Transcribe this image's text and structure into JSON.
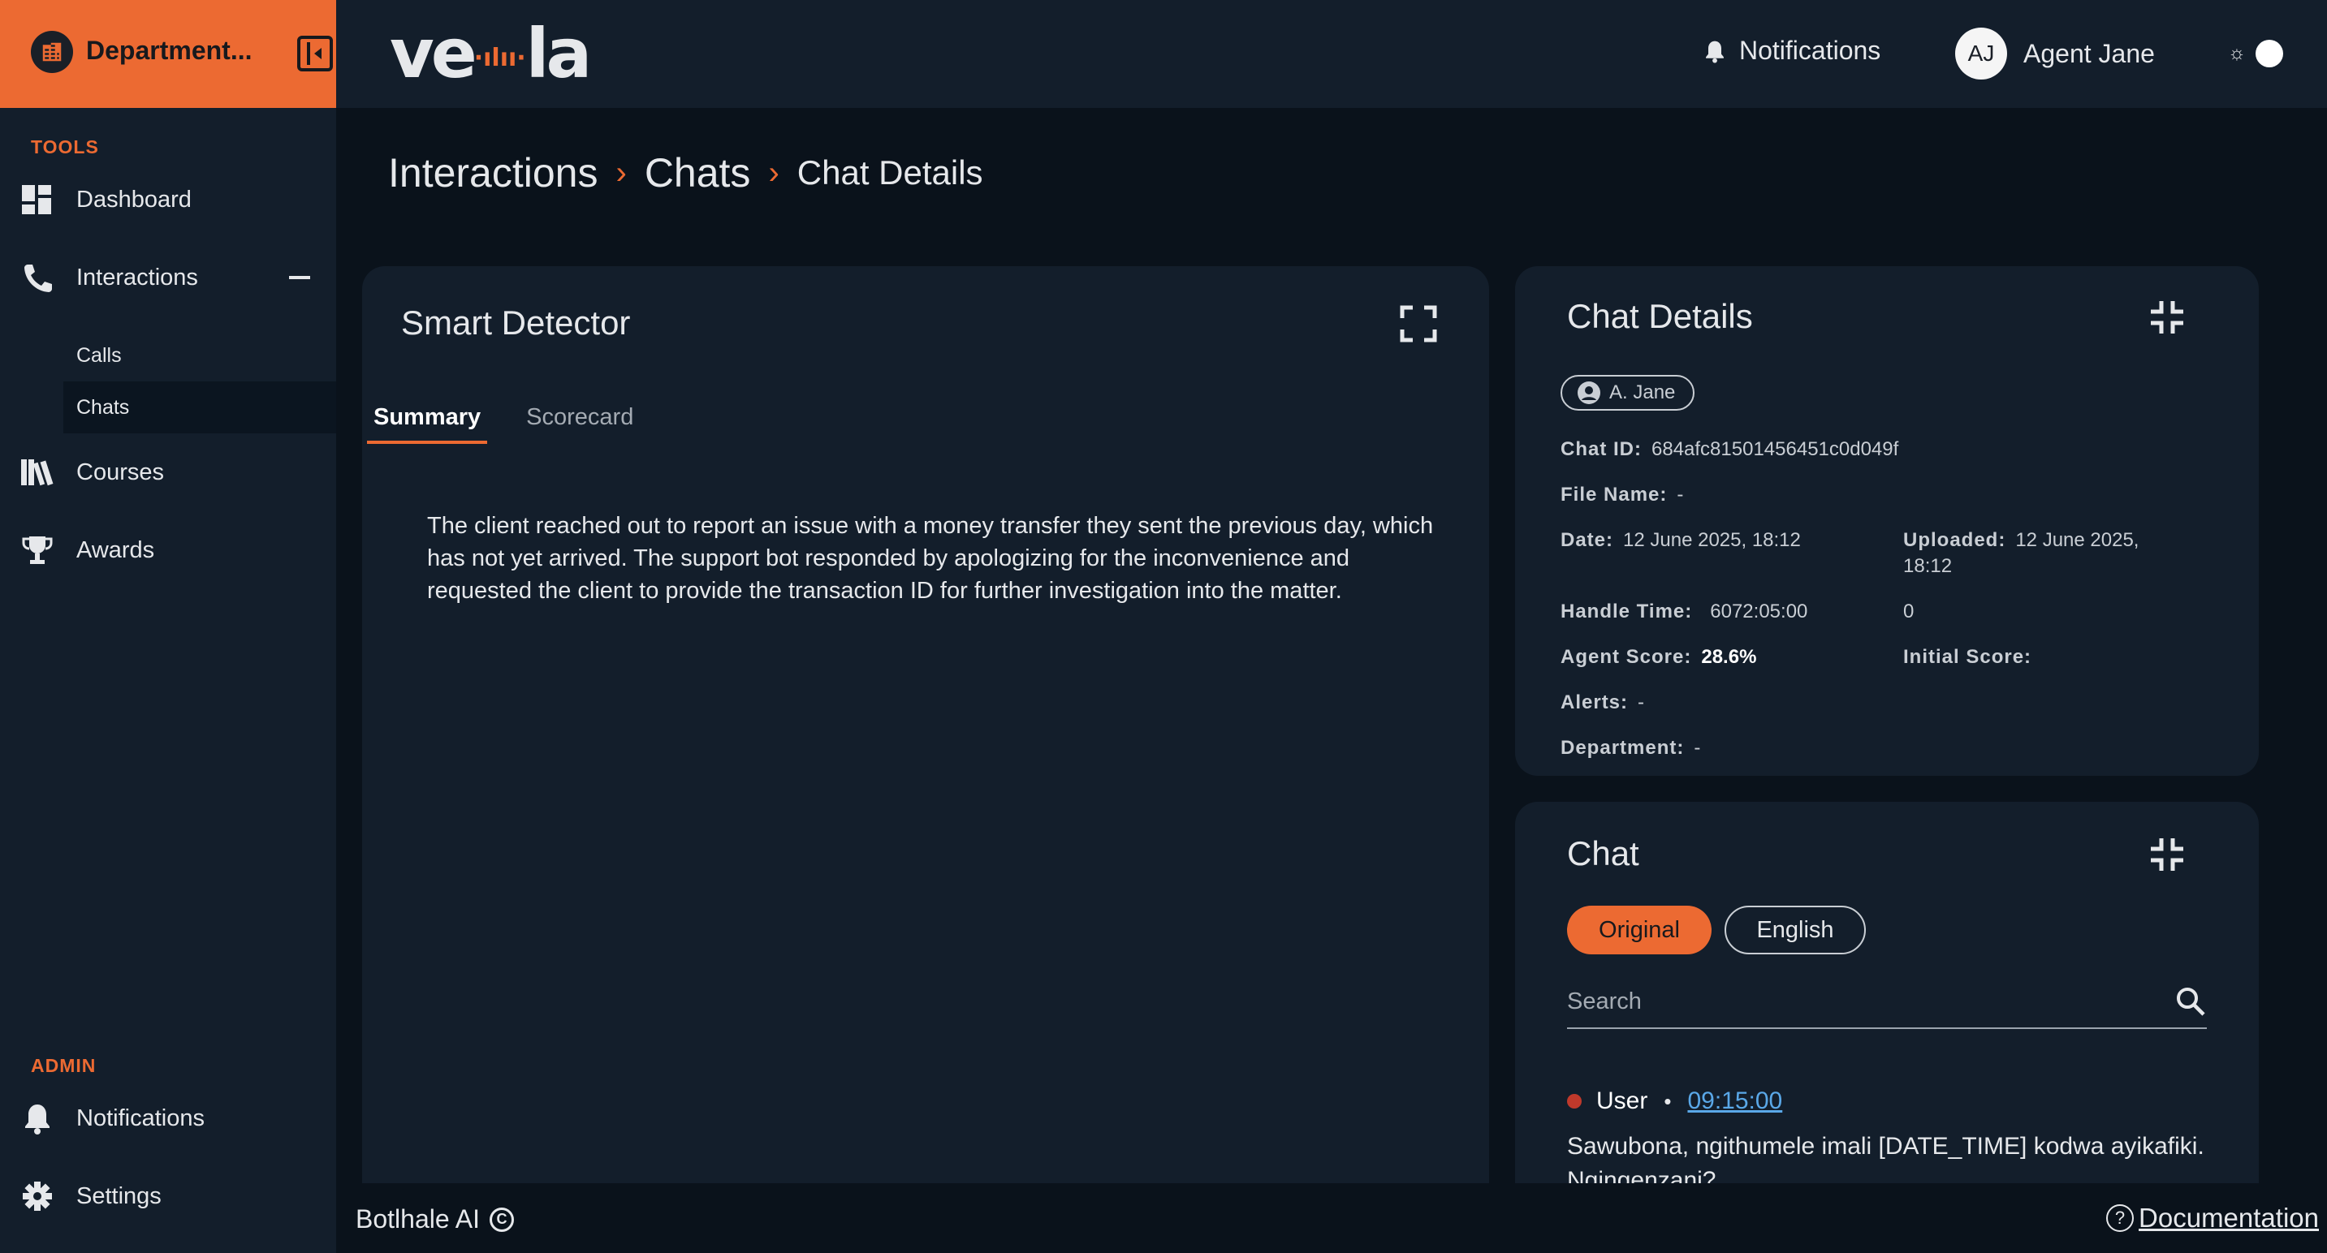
{
  "sidebar": {
    "department": "Department...",
    "tools_label": "TOOLS",
    "items": [
      {
        "label": "Dashboard",
        "icon": "dashboard-icon"
      },
      {
        "label": "Interactions",
        "icon": "phone-icon"
      },
      {
        "label": "Courses",
        "icon": "books-icon"
      },
      {
        "label": "Awards",
        "icon": "trophy-icon"
      }
    ],
    "sub_items": [
      {
        "label": "Calls"
      },
      {
        "label": "Chats"
      }
    ],
    "admin_label": "ADMIN",
    "admin_items": [
      {
        "label": "Notifications",
        "icon": "bell-icon"
      },
      {
        "label": "Settings",
        "icon": "gear-icon"
      }
    ]
  },
  "header": {
    "logo_text": "ve  la",
    "notifications": "Notifications",
    "user_initials": "AJ",
    "user_name": "Agent Jane"
  },
  "breadcrumb": {
    "items": [
      "Interactions",
      "Chats"
    ],
    "current": "Chat Details"
  },
  "smart_detector": {
    "title": "Smart Detector",
    "tabs": [
      "Summary",
      "Scorecard"
    ],
    "summary": "The client reached out to report an issue with a money transfer they sent the previous day, which has not yet arrived. The support bot responded by apologizing for the inconvenience and requested the client to provide the transaction ID for further investigation into the matter."
  },
  "chat_details": {
    "title": "Chat Details",
    "agent_chip": "A. Jane",
    "chat_id_label": "Chat ID:",
    "chat_id": "684afc81501456451c0d049f",
    "file_name_label": "File Name:",
    "file_name": "-",
    "date_label": "Date:",
    "date": "12 June 2025, 18:12",
    "uploaded_label": "Uploaded:",
    "uploaded": "12 June 2025,",
    "uploaded_time": "18:12",
    "handle_time_label": "Handle Time:",
    "handle_time": "6072:05:00",
    "handle_extra": "0",
    "agent_score_label": "Agent Score:",
    "agent_score": "28.6%",
    "initial_score_label": "Initial Score:",
    "alerts_label": "Alerts:",
    "alerts": "-",
    "department_label": "Department:",
    "department": "-"
  },
  "chat": {
    "title": "Chat",
    "lang_original": "Original",
    "lang_english": "English",
    "search_placeholder": "Search",
    "message_sender": "User",
    "message_time": "09:15:00",
    "message_text": "Sawubona, ngithumele imali [DATE_TIME] kodwa ayikafiki. Ngingenzani?"
  },
  "footer": {
    "brand": "Botlhale AI",
    "copyright_symbol": "C",
    "documentation": "Documentation"
  },
  "colors": {
    "accent": "#ec6a32",
    "panel": "#131e2b",
    "background": "#0a121b",
    "link": "#5aa8e8"
  }
}
